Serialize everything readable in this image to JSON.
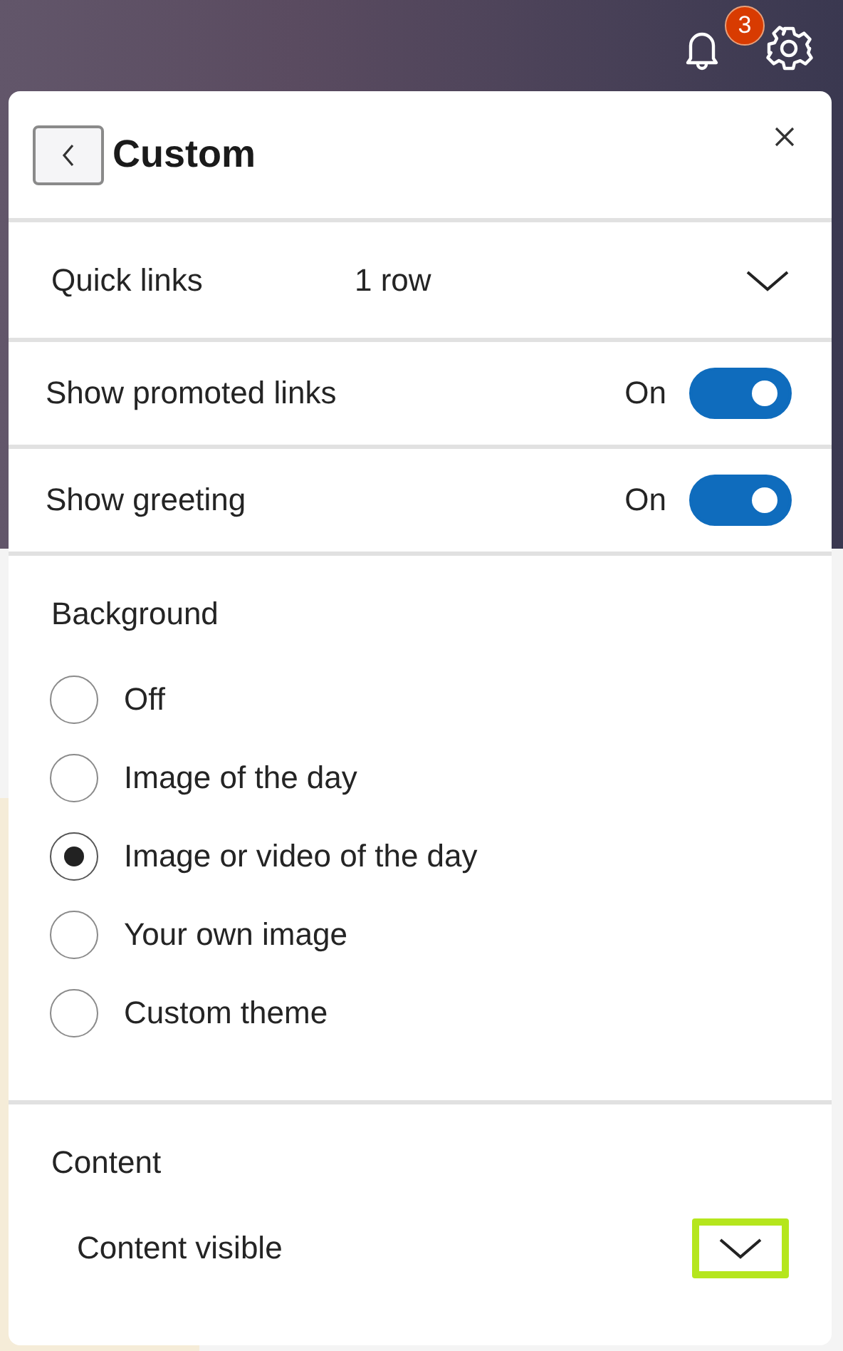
{
  "top_bar": {
    "notification_count": "3"
  },
  "panel": {
    "title": "Custom"
  },
  "quick_links": {
    "label": "Quick links",
    "value": "1 row"
  },
  "toggles": [
    {
      "label": "Show promoted links",
      "state_text": "On",
      "on": true
    },
    {
      "label": "Show greeting",
      "state_text": "On",
      "on": true
    }
  ],
  "background": {
    "heading": "Background",
    "options": [
      {
        "label": "Off",
        "selected": false
      },
      {
        "label": "Image of the day",
        "selected": false
      },
      {
        "label": "Image or video of the day",
        "selected": true
      },
      {
        "label": "Your own image",
        "selected": false
      },
      {
        "label": "Custom theme",
        "selected": false
      }
    ]
  },
  "content": {
    "heading": "Content",
    "value": "Content visible",
    "highlighted": true
  }
}
